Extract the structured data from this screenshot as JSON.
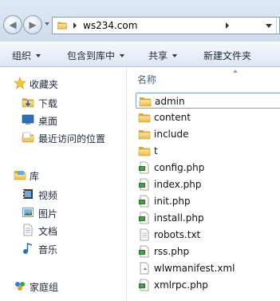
{
  "address_bar": {
    "path": "ws234.com"
  },
  "toolbar": {
    "organize": "组织",
    "include_in_library": "包含到库中",
    "share": "共享",
    "new_folder": "新建文件夹"
  },
  "nav": {
    "favorites": "收藏夹",
    "downloads": "下载",
    "desktop": "桌面",
    "recent": "最近访问的位置",
    "libraries": "库",
    "videos": "视频",
    "pictures": "图片",
    "documents": "文档",
    "music": "音乐",
    "homegroup": "家庭组"
  },
  "list": {
    "column_name": "名称",
    "items": [
      {
        "name": "admin",
        "icon": "folder-icon"
      },
      {
        "name": "content",
        "icon": "folder-icon"
      },
      {
        "name": "include",
        "icon": "folder-icon"
      },
      {
        "name": "t",
        "icon": "folder-icon"
      },
      {
        "name": "config.php",
        "icon": "php-file-icon"
      },
      {
        "name": "index.php",
        "icon": "php-file-icon"
      },
      {
        "name": "init.php",
        "icon": "php-file-icon"
      },
      {
        "name": "install.php",
        "icon": "php-file-icon"
      },
      {
        "name": "robots.txt",
        "icon": "text-file-icon"
      },
      {
        "name": "rss.php",
        "icon": "php-file-icon"
      },
      {
        "name": "wlwmanifest.xml",
        "icon": "xml-file-icon"
      },
      {
        "name": "xmlrpc.php",
        "icon": "php-file-icon"
      }
    ]
  }
}
